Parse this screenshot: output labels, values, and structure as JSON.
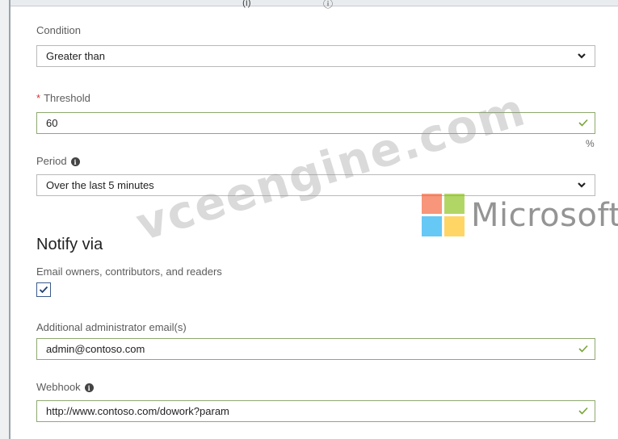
{
  "header_fragment": "(i)",
  "condition": {
    "label": "Condition",
    "value": "Greater than"
  },
  "threshold": {
    "required_marker": "*",
    "label": "Threshold",
    "value": "60",
    "unit": "%"
  },
  "period": {
    "label": "Period",
    "info_icon": "i",
    "value": "Over the last 5 minutes"
  },
  "notify": {
    "title": "Notify via",
    "email_owners_label": "Email owners, contributors, and readers",
    "email_owners_checked": true
  },
  "admin_email": {
    "label": "Additional administrator email(s)",
    "value": "admin@contoso.com"
  },
  "webhook": {
    "label": "Webhook",
    "info_icon": "i",
    "value": "http://www.contoso.com/dowork?param"
  },
  "watermark": {
    "text": "vceengine.com",
    "brand_text": "Microsoft",
    "brand_colors": [
      "#f25022",
      "#7fba00",
      "#00a4ef",
      "#ffb900"
    ]
  }
}
